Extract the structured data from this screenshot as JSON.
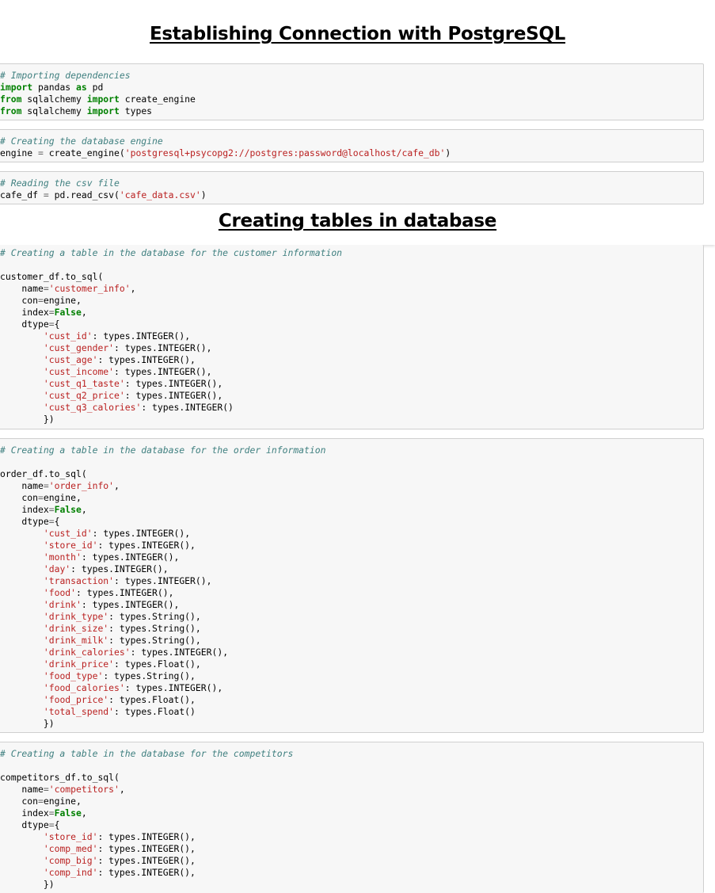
{
  "heading1": "Establishing Connection with PostgreSQL",
  "heading2": "Creating tables in database",
  "cells": [
    {
      "id": "imports",
      "lines": [
        [
          [
            "c",
            "# Importing dependencies"
          ]
        ],
        [
          [
            "k",
            "import"
          ],
          [
            "p",
            " pandas "
          ],
          [
            "k",
            "as"
          ],
          [
            "p",
            " pd"
          ]
        ],
        [
          [
            "k",
            "from"
          ],
          [
            "p",
            " sqlalchemy "
          ],
          [
            "k",
            "import"
          ],
          [
            "p",
            " create_engine"
          ]
        ],
        [
          [
            "k",
            "from"
          ],
          [
            "p",
            " sqlalchemy "
          ],
          [
            "k",
            "import"
          ],
          [
            "p",
            " types"
          ]
        ]
      ]
    },
    {
      "id": "engine",
      "lines": [
        [
          [
            "c",
            "# Creating the database engine"
          ]
        ],
        [
          [
            "p",
            "engine "
          ],
          [
            "e",
            "="
          ],
          [
            "p",
            " create_engine("
          ],
          [
            "s",
            "'postgresql+psycopg2://postgres:password@localhost/cafe_db'"
          ],
          [
            "p",
            ")"
          ]
        ]
      ]
    },
    {
      "id": "readcsv",
      "lines": [
        [
          [
            "c",
            "# Reading the csv file"
          ]
        ],
        [
          [
            "p",
            "cafe_df "
          ],
          [
            "e",
            "="
          ],
          [
            "p",
            " pd.read_csv("
          ],
          [
            "s",
            "'cafe_data.csv'"
          ],
          [
            "p",
            ")"
          ]
        ]
      ]
    },
    {
      "id": "customer",
      "lines": [
        [
          [
            "c",
            "# Creating a table in the database for the customer information"
          ]
        ],
        [
          [
            "p",
            ""
          ]
        ],
        [
          [
            "p",
            "customer_df.to_sql("
          ]
        ],
        [
          [
            "p",
            "    name"
          ],
          [
            "e",
            "="
          ],
          [
            "s",
            "'customer_info'"
          ],
          [
            "p",
            ","
          ]
        ],
        [
          [
            "p",
            "    con"
          ],
          [
            "e",
            "="
          ],
          [
            "p",
            "engine,"
          ]
        ],
        [
          [
            "p",
            "    index"
          ],
          [
            "e",
            "="
          ],
          [
            "k",
            "False"
          ],
          [
            "p",
            ","
          ]
        ],
        [
          [
            "p",
            "    dtype"
          ],
          [
            "e",
            "="
          ],
          [
            "p",
            "{"
          ]
        ],
        [
          [
            "p",
            "        "
          ],
          [
            "s",
            "'cust_id'"
          ],
          [
            "p",
            ": types.INTEGER(),"
          ]
        ],
        [
          [
            "p",
            "        "
          ],
          [
            "s",
            "'cust_gender'"
          ],
          [
            "p",
            ": types.INTEGER(),"
          ]
        ],
        [
          [
            "p",
            "        "
          ],
          [
            "s",
            "'cust_age'"
          ],
          [
            "p",
            ": types.INTEGER(),"
          ]
        ],
        [
          [
            "p",
            "        "
          ],
          [
            "s",
            "'cust_income'"
          ],
          [
            "p",
            ": types.INTEGER(),"
          ]
        ],
        [
          [
            "p",
            "        "
          ],
          [
            "s",
            "'cust_q1_taste'"
          ],
          [
            "p",
            ": types.INTEGER(),"
          ]
        ],
        [
          [
            "p",
            "        "
          ],
          [
            "s",
            "'cust_q2_price'"
          ],
          [
            "p",
            ": types.INTEGER(),"
          ]
        ],
        [
          [
            "p",
            "        "
          ],
          [
            "s",
            "'cust_q3_calories'"
          ],
          [
            "p",
            ": types.INTEGER()"
          ]
        ],
        [
          [
            "p",
            "        })"
          ]
        ]
      ]
    },
    {
      "id": "order",
      "lines": [
        [
          [
            "c",
            "# Creating a table in the database for the order information"
          ]
        ],
        [
          [
            "p",
            ""
          ]
        ],
        [
          [
            "p",
            "order_df.to_sql("
          ]
        ],
        [
          [
            "p",
            "    name"
          ],
          [
            "e",
            "="
          ],
          [
            "s",
            "'order_info'"
          ],
          [
            "p",
            ","
          ]
        ],
        [
          [
            "p",
            "    con"
          ],
          [
            "e",
            "="
          ],
          [
            "p",
            "engine,"
          ]
        ],
        [
          [
            "p",
            "    index"
          ],
          [
            "e",
            "="
          ],
          [
            "k",
            "False"
          ],
          [
            "p",
            ","
          ]
        ],
        [
          [
            "p",
            "    dtype"
          ],
          [
            "e",
            "="
          ],
          [
            "p",
            "{"
          ]
        ],
        [
          [
            "p",
            "        "
          ],
          [
            "s",
            "'cust_id'"
          ],
          [
            "p",
            ": types.INTEGER(),"
          ]
        ],
        [
          [
            "p",
            "        "
          ],
          [
            "s",
            "'store_id'"
          ],
          [
            "p",
            ": types.INTEGER(),"
          ]
        ],
        [
          [
            "p",
            "        "
          ],
          [
            "s",
            "'month'"
          ],
          [
            "p",
            ": types.INTEGER(),"
          ]
        ],
        [
          [
            "p",
            "        "
          ],
          [
            "s",
            "'day'"
          ],
          [
            "p",
            ": types.INTEGER(),"
          ]
        ],
        [
          [
            "p",
            "        "
          ],
          [
            "s",
            "'transaction'"
          ],
          [
            "p",
            ": types.INTEGER(),"
          ]
        ],
        [
          [
            "p",
            "        "
          ],
          [
            "s",
            "'food'"
          ],
          [
            "p",
            ": types.INTEGER(),"
          ]
        ],
        [
          [
            "p",
            "        "
          ],
          [
            "s",
            "'drink'"
          ],
          [
            "p",
            ": types.INTEGER(),"
          ]
        ],
        [
          [
            "p",
            "        "
          ],
          [
            "s",
            "'drink_type'"
          ],
          [
            "p",
            ": types.String(),"
          ]
        ],
        [
          [
            "p",
            "        "
          ],
          [
            "s",
            "'drink_size'"
          ],
          [
            "p",
            ": types.String(),"
          ]
        ],
        [
          [
            "p",
            "        "
          ],
          [
            "s",
            "'drink_milk'"
          ],
          [
            "p",
            ": types.String(),"
          ]
        ],
        [
          [
            "p",
            "        "
          ],
          [
            "s",
            "'drink_calories'"
          ],
          [
            "p",
            ": types.INTEGER(),"
          ]
        ],
        [
          [
            "p",
            "        "
          ],
          [
            "s",
            "'drink_price'"
          ],
          [
            "p",
            ": types.Float(),"
          ]
        ],
        [
          [
            "p",
            "        "
          ],
          [
            "s",
            "'food_type'"
          ],
          [
            "p",
            ": types.String(),"
          ]
        ],
        [
          [
            "p",
            "        "
          ],
          [
            "s",
            "'food_calories'"
          ],
          [
            "p",
            ": types.INTEGER(),"
          ]
        ],
        [
          [
            "p",
            "        "
          ],
          [
            "s",
            "'food_price'"
          ],
          [
            "p",
            ": types.Float(),"
          ]
        ],
        [
          [
            "p",
            "        "
          ],
          [
            "s",
            "'total_spend'"
          ],
          [
            "p",
            ": types.Float()"
          ]
        ],
        [
          [
            "p",
            "        })"
          ]
        ]
      ]
    },
    {
      "id": "competitors",
      "lines": [
        [
          [
            "c",
            "# Creating a table in the database for the competitors"
          ]
        ],
        [
          [
            "p",
            ""
          ]
        ],
        [
          [
            "p",
            "competitors_df.to_sql("
          ]
        ],
        [
          [
            "p",
            "    name"
          ],
          [
            "e",
            "="
          ],
          [
            "s",
            "'competitors'"
          ],
          [
            "p",
            ","
          ]
        ],
        [
          [
            "p",
            "    con"
          ],
          [
            "e",
            "="
          ],
          [
            "p",
            "engine,"
          ]
        ],
        [
          [
            "p",
            "    index"
          ],
          [
            "e",
            "="
          ],
          [
            "k",
            "False"
          ],
          [
            "p",
            ","
          ]
        ],
        [
          [
            "p",
            "    dtype"
          ],
          [
            "e",
            "="
          ],
          [
            "p",
            "{"
          ]
        ],
        [
          [
            "p",
            "        "
          ],
          [
            "s",
            "'store_id'"
          ],
          [
            "p",
            ": types.INTEGER(),"
          ]
        ],
        [
          [
            "p",
            "        "
          ],
          [
            "s",
            "'comp_med'"
          ],
          [
            "p",
            ": types.INTEGER(),"
          ]
        ],
        [
          [
            "p",
            "        "
          ],
          [
            "s",
            "'comp_big'"
          ],
          [
            "p",
            ": types.INTEGER(),"
          ]
        ],
        [
          [
            "p",
            "        "
          ],
          [
            "s",
            "'comp_ind'"
          ],
          [
            "p",
            ": types.INTEGER(),"
          ]
        ],
        [
          [
            "p",
            "        })"
          ]
        ]
      ]
    }
  ]
}
